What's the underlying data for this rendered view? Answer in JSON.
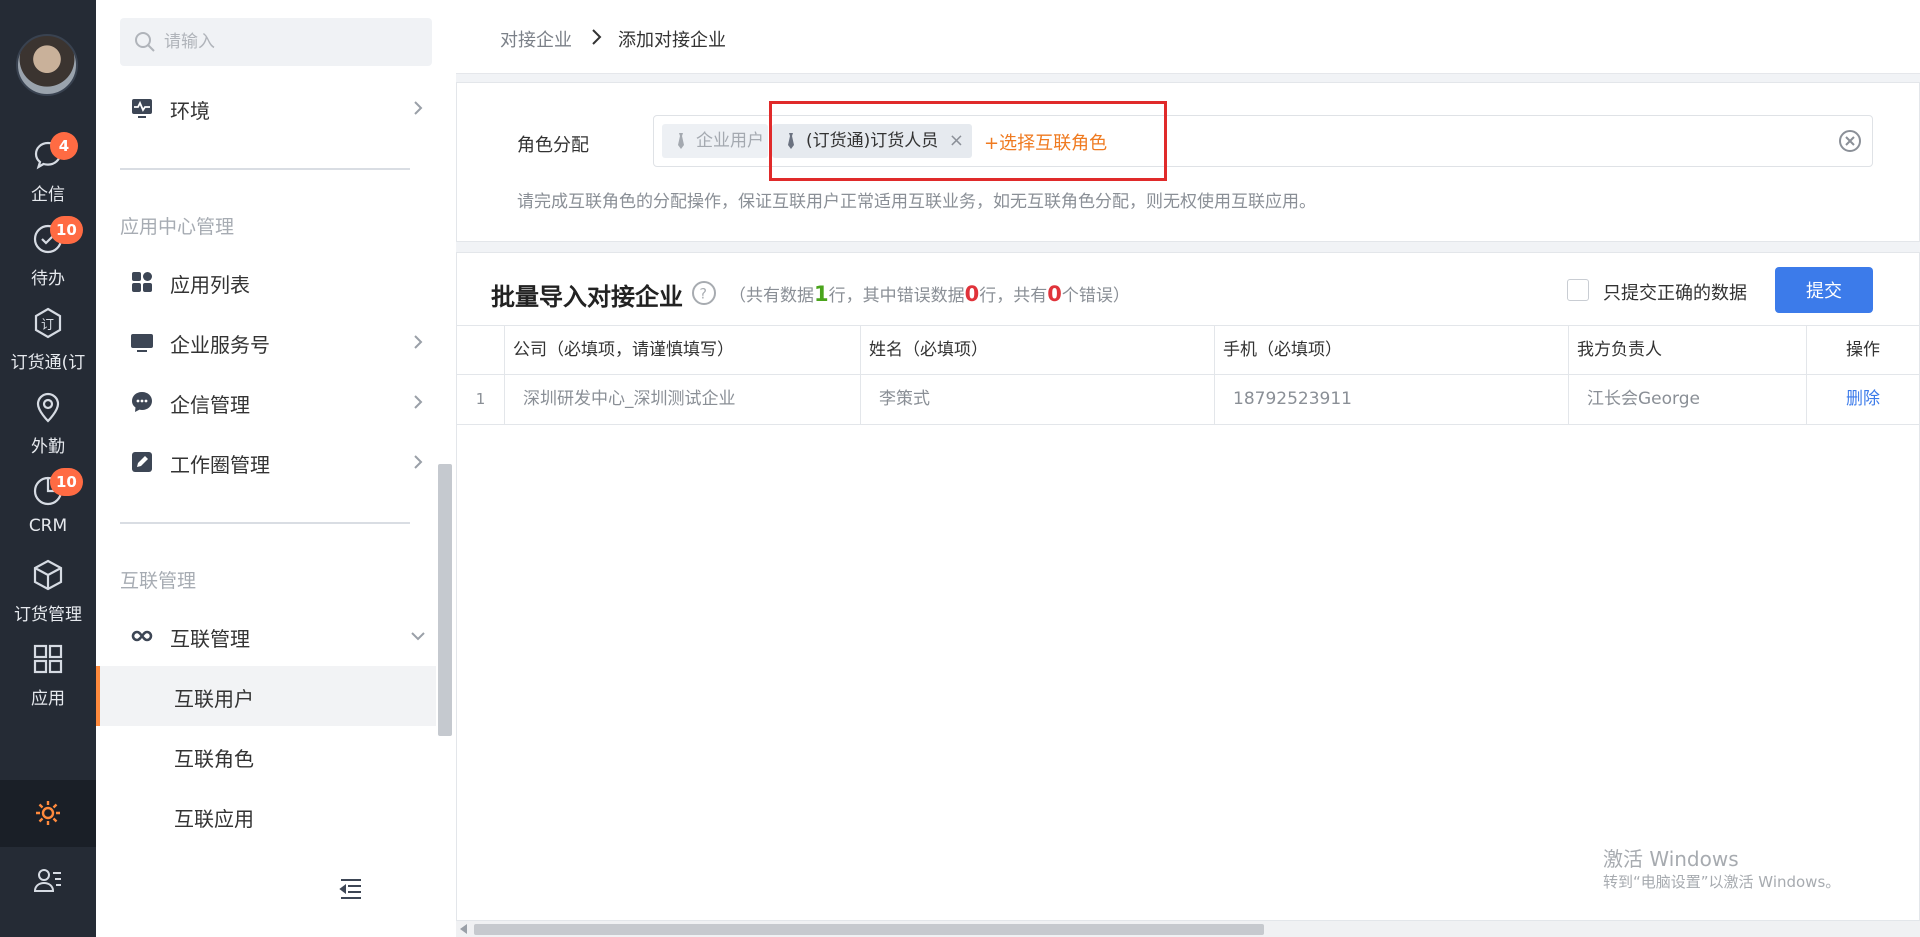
{
  "rail": {
    "items": [
      {
        "label": "企信",
        "icon": "chat-bubble-icon",
        "badge": "4"
      },
      {
        "label": "待办",
        "icon": "check-circle-icon",
        "badge": "10"
      },
      {
        "label": "订货通(订",
        "icon": "order-hexagon-icon",
        "badge": ""
      },
      {
        "label": "外勤",
        "icon": "location-pin-icon",
        "badge": ""
      },
      {
        "label": "CRM",
        "icon": "pie-chart-icon",
        "badge": "10"
      },
      {
        "label": "订货管理",
        "icon": "cube-icon",
        "badge": ""
      },
      {
        "label": "应用",
        "icon": "apps-grid-icon",
        "badge": ""
      }
    ]
  },
  "sidebar": {
    "search_placeholder": "请输入",
    "env_label": "环境",
    "section_app": "应用中心管理",
    "app_items": [
      {
        "label": "应用列表"
      },
      {
        "label": "企业服务号"
      },
      {
        "label": "企信管理"
      },
      {
        "label": "工作圈管理"
      }
    ],
    "section_interconnect": "互联管理",
    "interconnect_label": "互联管理",
    "sub_items": [
      {
        "label": "互联用户"
      },
      {
        "label": "互联角色"
      },
      {
        "label": "互联应用"
      }
    ]
  },
  "breadcrumb": {
    "parent": "对接企业",
    "current": "添加对接企业"
  },
  "roles": {
    "label": "角色分配",
    "tag_disabled": "企业用户",
    "tag_active": "(订货通)订货人员",
    "tag_remove": "×",
    "add_label": "+选择互联角色",
    "hint": "请完成互联角色的分配操作，保证互联用户正常适用互联业务，如无互联角色分配，则无权使用互联应用。"
  },
  "import": {
    "title": "批量导入对接企业",
    "stats_prefix": "（共有数据",
    "total_rows": "1",
    "stats_mid1": "行，其中错误数据",
    "error_rows": "0",
    "stats_mid2": "行，共有",
    "error_count": "0",
    "stats_suffix": "个错误）",
    "only_correct_label": "只提交正确的数据",
    "submit_label": "提交",
    "columns": {
      "company": "公司（必填项，请谨慎填写）",
      "name": "姓名（必填项）",
      "phone": "手机（必填项）",
      "manager": "我方负责人",
      "op": "操作"
    },
    "rows": [
      {
        "idx": "1",
        "company": "深圳研发中心_深圳测试企业",
        "name": "李策式",
        "phone": "18792523911",
        "manager": "江长会George",
        "op": "删除"
      }
    ]
  },
  "watermark": {
    "line1": "激活 Windows",
    "line2": "转到“电脑设置”以激活 Windows。"
  },
  "colors": {
    "accent": "#3c7bea",
    "orange": "#ef7a20",
    "badge": "#ff6b43",
    "highlight": "#e02a2a",
    "rail": "#252b35"
  }
}
